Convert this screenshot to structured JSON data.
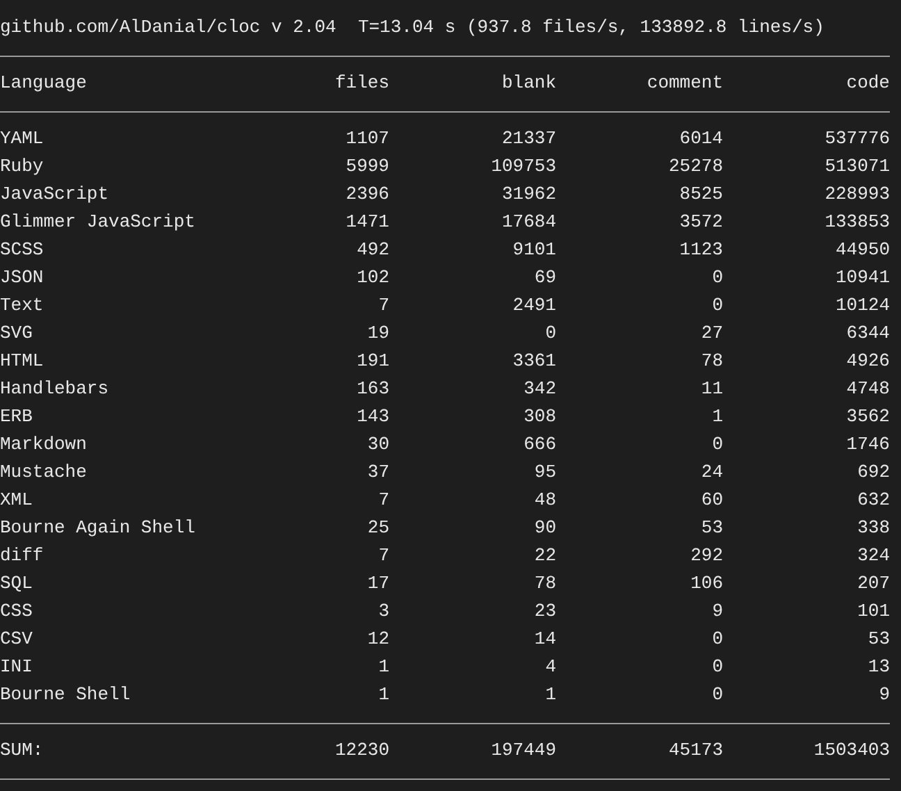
{
  "summary": "github.com/AlDanial/cloc v 2.04  T=13.04 s (937.8 files/s, 133892.8 lines/s)",
  "columns": [
    "Language",
    "files",
    "blank",
    "comment",
    "code"
  ],
  "rows": [
    [
      "YAML",
      "1107",
      "21337",
      "6014",
      "537776"
    ],
    [
      "Ruby",
      "5999",
      "109753",
      "25278",
      "513071"
    ],
    [
      "JavaScript",
      "2396",
      "31962",
      "8525",
      "228993"
    ],
    [
      "Glimmer JavaScript",
      "1471",
      "17684",
      "3572",
      "133853"
    ],
    [
      "SCSS",
      "492",
      "9101",
      "1123",
      "44950"
    ],
    [
      "JSON",
      "102",
      "69",
      "0",
      "10941"
    ],
    [
      "Text",
      "7",
      "2491",
      "0",
      "10124"
    ],
    [
      "SVG",
      "19",
      "0",
      "27",
      "6344"
    ],
    [
      "HTML",
      "191",
      "3361",
      "78",
      "4926"
    ],
    [
      "Handlebars",
      "163",
      "342",
      "11",
      "4748"
    ],
    [
      "ERB",
      "143",
      "308",
      "1",
      "3562"
    ],
    [
      "Markdown",
      "30",
      "666",
      "0",
      "1746"
    ],
    [
      "Mustache",
      "37",
      "95",
      "24",
      "692"
    ],
    [
      "XML",
      "7",
      "48",
      "60",
      "632"
    ],
    [
      "Bourne Again Shell",
      "25",
      "90",
      "53",
      "338"
    ],
    [
      "diff",
      "7",
      "22",
      "292",
      "324"
    ],
    [
      "SQL",
      "17",
      "78",
      "106",
      "207"
    ],
    [
      "CSS",
      "3",
      "23",
      "9",
      "101"
    ],
    [
      "CSV",
      "12",
      "14",
      "0",
      "53"
    ],
    [
      "INI",
      "1",
      "4",
      "0",
      "13"
    ],
    [
      "Bourne Shell",
      "1",
      "1",
      "0",
      "9"
    ]
  ],
  "sum": [
    "SUM:",
    "12230",
    "197449",
    "45173",
    "1503403"
  ]
}
